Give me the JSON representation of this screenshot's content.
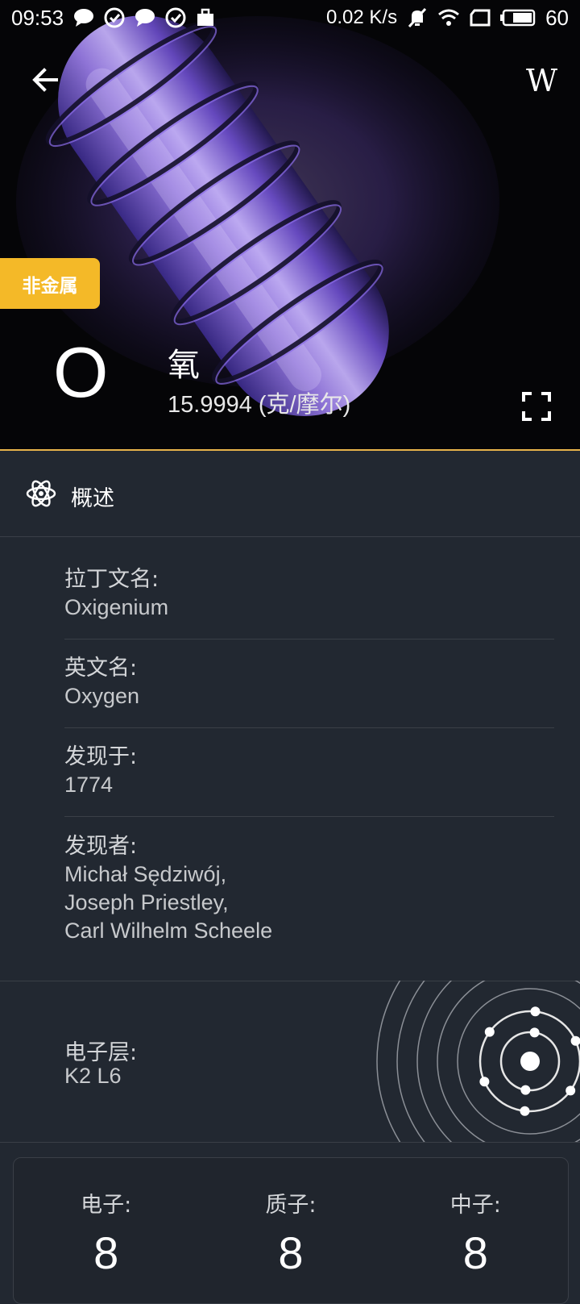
{
  "status_bar": {
    "time": "09:53",
    "net_speed": "0.02 K/s",
    "battery": "60",
    "icons": [
      "chat-bubble-icon",
      "check-circle-icon",
      "chat-bubble-icon",
      "check-circle-icon",
      "briefcase-icon",
      "mute-bell-icon",
      "wifi-icon",
      "sim-icon",
      "battery-icon"
    ]
  },
  "header": {
    "back_icon": "arrow-left-icon",
    "wiki_label": "W",
    "category": "非金属",
    "category_color": "#f4b928",
    "symbol": "O",
    "name": "氧",
    "atomic_mass": "15.9994 (克/摩尔)",
    "fullscreen_icon": "fullscreen-icon",
    "accent_line_color": "#e8b34a"
  },
  "tab": {
    "icon": "atom-icon",
    "label": "概述"
  },
  "details": {
    "latin_name": {
      "label": "拉丁文名:",
      "value": "Oxigenium"
    },
    "english_name": {
      "label": "英文名:",
      "value": "Oxygen"
    },
    "discovered_in": {
      "label": "发现于:",
      "value": "1774"
    },
    "discovered_by": {
      "label": "发现者:",
      "lines": [
        "Michał Sędziwój,",
        "Joseph Priestley,",
        "Carl Wilhelm Scheele"
      ]
    }
  },
  "electron_shells": {
    "label": "电子层:",
    "value": "K2 L6",
    "shell_electrons": [
      2,
      6
    ]
  },
  "counts": {
    "electrons": {
      "label": "电子:",
      "value": "8"
    },
    "protons": {
      "label": "质子:",
      "value": "8"
    },
    "neutrons": {
      "label": "中子:",
      "value": "8"
    }
  }
}
